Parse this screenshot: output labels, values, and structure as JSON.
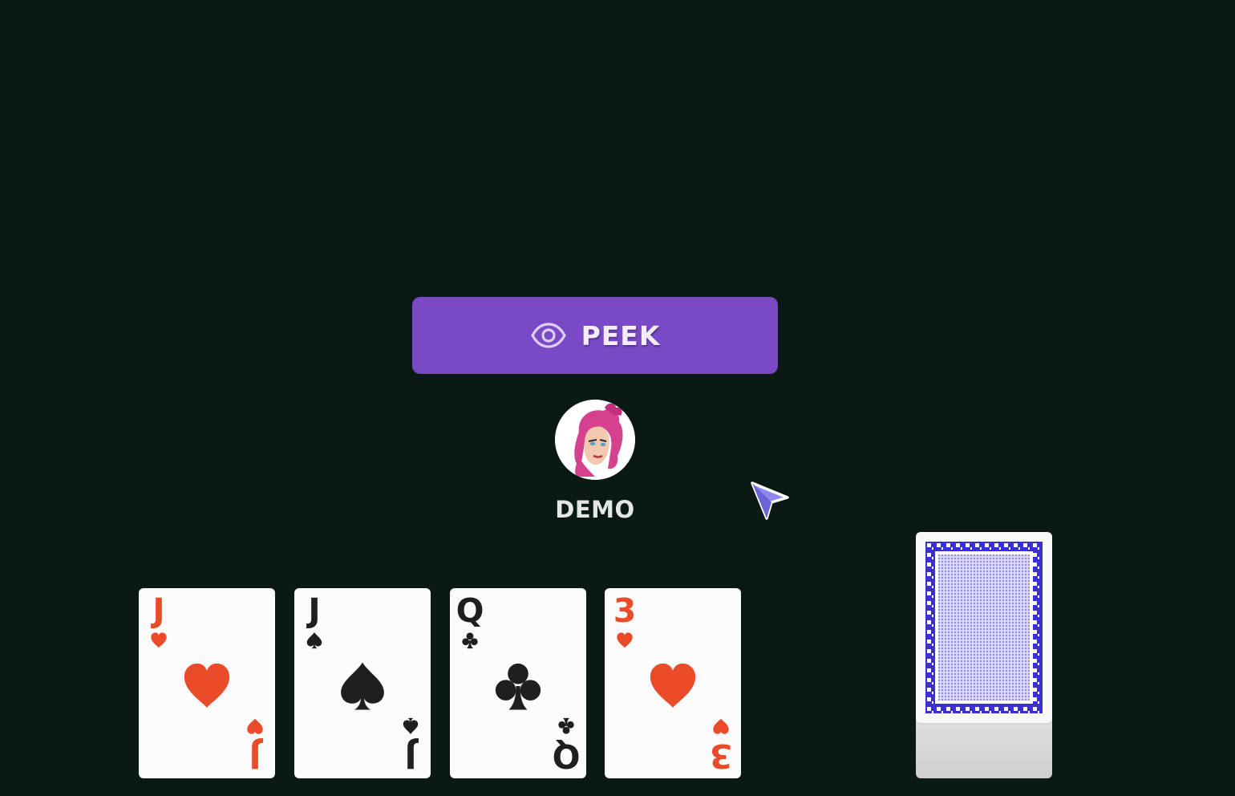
{
  "peek_button": {
    "label": "PEEK",
    "icon": "eye-icon",
    "color": "#7a4ac6"
  },
  "player": {
    "name": "DEMO",
    "avatar": "avatar-pink-hair"
  },
  "hand": [
    {
      "rank": "J",
      "suit": "hearts",
      "color": "#ea4c2a"
    },
    {
      "rank": "J",
      "suit": "spades",
      "color": "#1f1f1f"
    },
    {
      "rank": "Q",
      "suit": "clubs",
      "color": "#1f1f1f"
    },
    {
      "rank": "3",
      "suit": "hearts",
      "color": "#ea4c2a"
    }
  ],
  "deck": {
    "card_back_color": "#3a2fd6"
  },
  "background_color": "#0a1914"
}
